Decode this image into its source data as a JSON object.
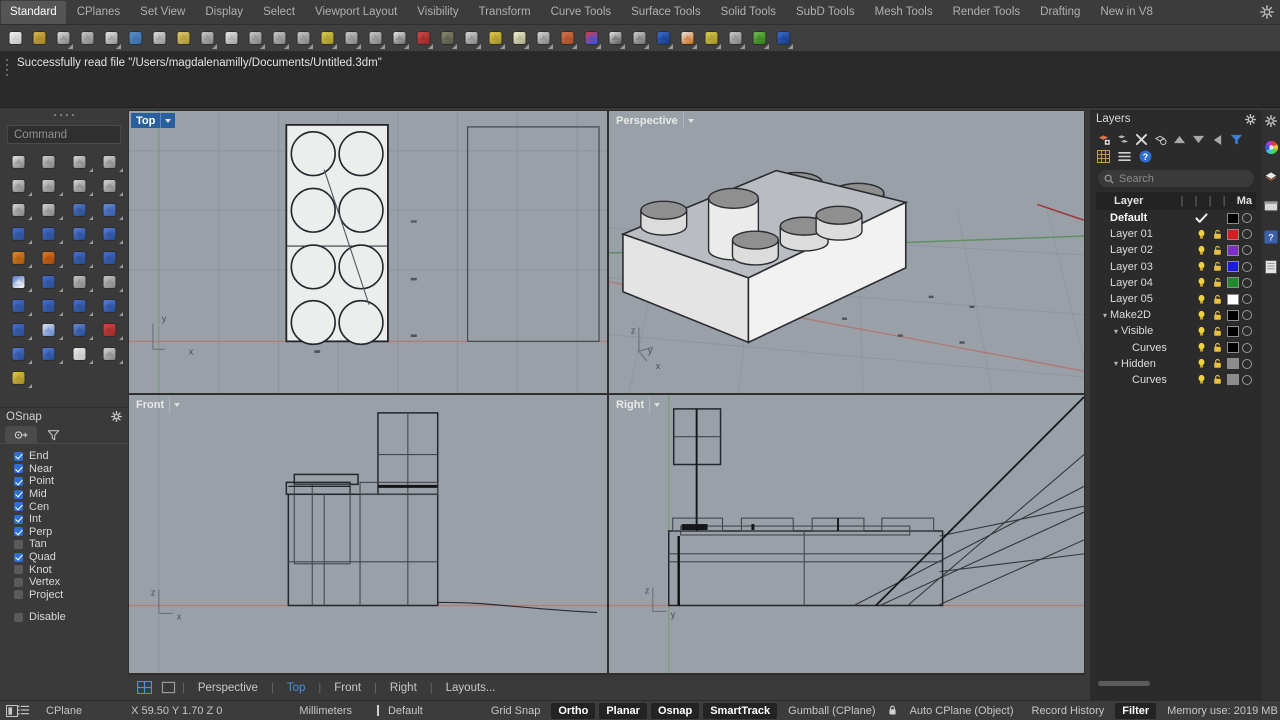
{
  "app": {
    "title": "Rhinoceros",
    "menu_tabs": [
      {
        "label": "Standard",
        "active": true
      },
      {
        "label": "CPlanes",
        "active": false
      },
      {
        "label": "Set View",
        "active": false
      },
      {
        "label": "Display",
        "active": false
      },
      {
        "label": "Select",
        "active": false
      },
      {
        "label": "Viewport Layout",
        "active": false
      },
      {
        "label": "Visibility",
        "active": false
      },
      {
        "label": "Transform",
        "active": false
      },
      {
        "label": "Curve Tools",
        "active": false
      },
      {
        "label": "Surface Tools",
        "active": false
      },
      {
        "label": "Solid Tools",
        "active": false
      },
      {
        "label": "SubD Tools",
        "active": false
      },
      {
        "label": "Mesh Tools",
        "active": false
      },
      {
        "label": "Render Tools",
        "active": false
      },
      {
        "label": "Drafting",
        "active": false
      },
      {
        "label": "New in V8",
        "active": false
      }
    ],
    "menubar_gear": "gear-icon"
  },
  "toolbar": {
    "icons": [
      {
        "name": "new-file-icon",
        "flyout": false
      },
      {
        "name": "open-file-icon",
        "flyout": false
      },
      {
        "name": "save-file-icon",
        "flyout": true
      },
      {
        "name": "print-icon",
        "flyout": false
      },
      {
        "name": "copy-view-icon",
        "flyout": true
      },
      {
        "name": "cut-icon",
        "flyout": false
      },
      {
        "name": "copy-icon",
        "flyout": false
      },
      {
        "name": "paste-icon",
        "flyout": false
      },
      {
        "name": "undo-icon",
        "flyout": true
      },
      {
        "name": "pan-icon",
        "flyout": false
      },
      {
        "name": "zoom-extents-icon",
        "flyout": true
      },
      {
        "name": "zoom-window-icon",
        "flyout": true
      },
      {
        "name": "zoom-selected-icon",
        "flyout": true
      },
      {
        "name": "zoom-target-icon",
        "flyout": true
      },
      {
        "name": "zoom-dynamic-icon",
        "flyout": true
      },
      {
        "name": "rotate-view-icon",
        "flyout": true
      },
      {
        "name": "viewport-layout-icon",
        "flyout": true
      },
      {
        "name": "render-icon",
        "flyout": true
      },
      {
        "name": "render-preview-icon",
        "flyout": true
      },
      {
        "name": "cplane-icon",
        "flyout": true
      },
      {
        "name": "point-editing-icon",
        "flyout": true
      },
      {
        "name": "light-icon",
        "flyout": true
      },
      {
        "name": "lock-icon",
        "flyout": true
      },
      {
        "name": "layer-icon",
        "flyout": true
      },
      {
        "name": "color-wheel-icon",
        "flyout": true
      },
      {
        "name": "shaded-view-icon",
        "flyout": true
      },
      {
        "name": "ghosted-view-icon",
        "flyout": true
      },
      {
        "name": "render-sphere-icon",
        "flyout": true
      },
      {
        "name": "material-icon",
        "flyout": true
      },
      {
        "name": "options-gear-icon",
        "flyout": true
      },
      {
        "name": "dimension-icon",
        "flyout": true
      },
      {
        "name": "grasshopper-icon",
        "flyout": true
      },
      {
        "name": "help-icon",
        "flyout": true
      }
    ]
  },
  "command_history": {
    "line": "Successfully read file \"/Users/magdalenamilly/Documents/Untitled.3dm\""
  },
  "command_panel": {
    "input_placeholder": "Command",
    "tools": [
      {
        "name": "select-arrow-icon",
        "flyout": false
      },
      {
        "name": "point-icon",
        "flyout": false
      },
      {
        "name": "polyline-icon",
        "flyout": true
      },
      {
        "name": "curve-icon",
        "flyout": true
      },
      {
        "name": "circle-icon",
        "flyout": true
      },
      {
        "name": "ellipse-icon",
        "flyout": true
      },
      {
        "name": "arc-icon",
        "flyout": true
      },
      {
        "name": "rectangle-icon",
        "flyout": true
      },
      {
        "name": "polygon-icon",
        "flyout": true
      },
      {
        "name": "fillet-icon",
        "flyout": true
      },
      {
        "name": "surface-from-curves-icon",
        "flyout": true
      },
      {
        "name": "loft-icon",
        "flyout": true
      },
      {
        "name": "box-icon",
        "flyout": true
      },
      {
        "name": "sphere-icon",
        "flyout": true
      },
      {
        "name": "cylinder-icon",
        "flyout": true
      },
      {
        "name": "surface-edit-icon",
        "flyout": true
      },
      {
        "name": "explode-icon",
        "flyout": true
      },
      {
        "name": "join-icon",
        "flyout": true
      },
      {
        "name": "trim-icon",
        "flyout": true
      },
      {
        "name": "split-icon",
        "flyout": true
      },
      {
        "name": "boolean-union-icon",
        "flyout": true
      },
      {
        "name": "boolean-difference-icon",
        "flyout": true
      },
      {
        "name": "offset-curve-icon",
        "flyout": true
      },
      {
        "name": "offset-surface-icon",
        "flyout": true
      },
      {
        "name": "text-icon",
        "flyout": true
      },
      {
        "name": "dimension-linear-icon",
        "flyout": true
      },
      {
        "name": "array-icon",
        "flyout": true
      },
      {
        "name": "mirror-icon",
        "flyout": true
      },
      {
        "name": "extrude-icon",
        "flyout": true
      },
      {
        "name": "cage-edit-icon",
        "flyout": true
      },
      {
        "name": "point-grid-icon",
        "flyout": true
      },
      {
        "name": "analyze-icon",
        "flyout": true
      },
      {
        "name": "paint-icon",
        "flyout": true
      },
      {
        "name": "flow-icon",
        "flyout": true
      },
      {
        "name": "check-icon",
        "flyout": true
      },
      {
        "name": "mesh-icon",
        "flyout": true
      },
      {
        "name": "render-gold-icon",
        "flyout": true
      }
    ]
  },
  "osnap": {
    "title": "OSnap",
    "gear": "gear-icon",
    "tabs": [
      {
        "name": "osnap-tab-snaps",
        "active": true,
        "icon": "osnap-icon"
      },
      {
        "name": "osnap-tab-filter",
        "active": false,
        "icon": "filter-icon"
      }
    ],
    "snaps": [
      {
        "label": "End",
        "checked": true
      },
      {
        "label": "Near",
        "checked": true
      },
      {
        "label": "Point",
        "checked": true
      },
      {
        "label": "Mid",
        "checked": true
      },
      {
        "label": "Cen",
        "checked": true
      },
      {
        "label": "Int",
        "checked": true
      },
      {
        "label": "Perp",
        "checked": true
      },
      {
        "label": "Tan",
        "checked": false
      },
      {
        "label": "Quad",
        "checked": true
      },
      {
        "label": "Knot",
        "checked": false
      },
      {
        "label": "Vertex",
        "checked": false
      },
      {
        "label": "Project",
        "checked": false
      }
    ],
    "disable": {
      "label": "Disable",
      "checked": false
    }
  },
  "viewports": [
    {
      "name": "viewport-top",
      "label": "Top",
      "active": true
    },
    {
      "name": "viewport-perspective",
      "label": "Perspective",
      "active": false
    },
    {
      "name": "viewport-front",
      "label": "Front",
      "active": false
    },
    {
      "name": "viewport-right",
      "label": "Right",
      "active": false
    }
  ],
  "viewport_tabs": {
    "icons": [
      {
        "name": "four-view-layout-icon",
        "active": true
      },
      {
        "name": "single-view-layout-icon",
        "active": false
      }
    ],
    "tabs": [
      {
        "label": "Perspective",
        "active": false
      },
      {
        "label": "Top",
        "active": true
      },
      {
        "label": "Front",
        "active": false
      },
      {
        "label": "Right",
        "active": false
      },
      {
        "label": "Layouts...",
        "active": false
      }
    ],
    "separator": "|"
  },
  "layers_panel": {
    "title": "Layers",
    "gear": "gear-icon",
    "tools_row1": [
      "new-layer-icon",
      "new-sublayer-icon",
      "delete-layer-icon",
      "duplicate-layer-icon",
      "move-up-icon",
      "move-down-icon",
      "move-left-icon",
      "filter-icon"
    ],
    "tools_row2": [
      "grid-view-icon",
      "list-view-icon",
      "help-icon"
    ],
    "search_placeholder": "Search",
    "search_value": "",
    "header": {
      "layer": "Layer",
      "material": "Ma"
    },
    "rows": [
      {
        "name": "Default",
        "indent": 0,
        "twisty": "",
        "bold": true,
        "current": true,
        "bulb": false,
        "lock": false,
        "color": "#000000"
      },
      {
        "name": "Layer 01",
        "indent": 0,
        "twisty": "",
        "bold": false,
        "current": false,
        "bulb": true,
        "lock": true,
        "color": "#cc2222"
      },
      {
        "name": "Layer 02",
        "indent": 0,
        "twisty": "",
        "bold": false,
        "current": false,
        "bulb": true,
        "lock": true,
        "color": "#7d2ec9"
      },
      {
        "name": "Layer 03",
        "indent": 0,
        "twisty": "",
        "bold": false,
        "current": false,
        "bulb": true,
        "lock": true,
        "color": "#1a1ae0"
      },
      {
        "name": "Layer 04",
        "indent": 0,
        "twisty": "",
        "bold": false,
        "current": false,
        "bulb": true,
        "lock": true,
        "color": "#1e8c2e"
      },
      {
        "name": "Layer 05",
        "indent": 0,
        "twisty": "",
        "bold": false,
        "current": false,
        "bulb": true,
        "lock": true,
        "color": "#ffffff"
      },
      {
        "name": "Make2D",
        "indent": 0,
        "twisty": "v",
        "bold": false,
        "current": false,
        "bulb": true,
        "lock": true,
        "color": "#000000"
      },
      {
        "name": "Visible",
        "indent": 1,
        "twisty": "v",
        "bold": false,
        "current": false,
        "bulb": true,
        "lock": true,
        "color": "#000000"
      },
      {
        "name": "Curves",
        "indent": 2,
        "twisty": "",
        "bold": false,
        "current": false,
        "bulb": true,
        "lock": true,
        "color": "#000000"
      },
      {
        "name": "Hidden",
        "indent": 1,
        "twisty": "v",
        "bold": false,
        "current": false,
        "bulb": true,
        "lock": true,
        "color": "#8c8c8c"
      },
      {
        "name": "Curves",
        "indent": 2,
        "twisty": "",
        "bold": false,
        "current": false,
        "bulb": true,
        "lock": true,
        "color": "#8c8c8c"
      }
    ]
  },
  "right_strip": {
    "icons": [
      "gear-icon",
      "color-wheel-icon",
      "materials-icon",
      "display-icon",
      "help-icon",
      "notes-icon"
    ]
  },
  "statusbar": {
    "left_icons": [
      "panel-toggle-icon",
      "list-icon"
    ],
    "cplane_label": "CPlane",
    "coordinates": "X 59.50 Y 1.70 Z 0",
    "units": "Millimeters",
    "layer_swatch_color": "#000000",
    "layer_name": "Default",
    "toggles": [
      {
        "label": "Grid Snap",
        "on": false
      },
      {
        "label": "Ortho",
        "on": true
      },
      {
        "label": "Planar",
        "on": true
      },
      {
        "label": "Osnap",
        "on": true
      },
      {
        "label": "SmartTrack",
        "on": true
      },
      {
        "label": "Gumball (CPlane)",
        "on": false
      },
      {
        "label": "Auto CPlane (Object)",
        "on": false,
        "lock_icon": true
      },
      {
        "label": "Record History",
        "on": false
      },
      {
        "label": "Filter",
        "on": true
      }
    ],
    "memory": "Memory use: 2019 MB",
    "right_icon": "maximize-icon"
  },
  "colors": {
    "viewport_bg": "#9aa0a8",
    "accent_blue": "#2a5f9e",
    "tab_active_blue": "#4a90e2",
    "panel_bg": "#3a3a3a",
    "dark_bg": "#2b2b2b",
    "grid_line": "#8f959d",
    "x_axis_red": "#b07070",
    "y_axis_green": "#6f9a6f",
    "brick_light": "#efefef",
    "brick_mid": "#cfcfcf",
    "brick_dark": "#9d9d9d",
    "brick_top": "#888888"
  }
}
